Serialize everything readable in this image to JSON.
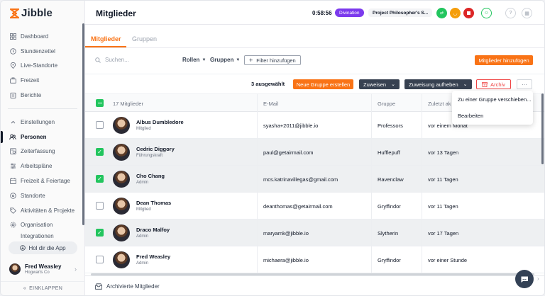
{
  "app": {
    "brand": "Jibble"
  },
  "sidebar": {
    "items_top": [
      {
        "label": "Dashboard",
        "icon": "grid-icon"
      },
      {
        "label": "Stundenzettel",
        "icon": "clock-icon"
      },
      {
        "label": "Live-Standorte",
        "icon": "pin-icon"
      },
      {
        "label": "Freizeit",
        "icon": "suitcase-icon"
      },
      {
        "label": "Berichte",
        "icon": "clipboard-icon"
      }
    ],
    "settings_label": "Einstellungen",
    "items_settings": [
      {
        "label": "Personen",
        "icon": "people-icon",
        "active": true
      },
      {
        "label": "Zeiterfassung",
        "icon": "timesheet-icon"
      },
      {
        "label": "Arbeitspläne",
        "icon": "schedule-icon"
      },
      {
        "label": "Freizeit & Feiertage",
        "icon": "calendar-icon"
      },
      {
        "label": "Standorte",
        "icon": "pin-icon"
      },
      {
        "label": "Aktivitäten & Projekte",
        "icon": "tag-icon"
      },
      {
        "label": "Organisation",
        "icon": "gear-icon"
      },
      {
        "label": "Integrationen",
        "icon": "plug-icon"
      }
    ],
    "get_app_label": "Hol dir die App",
    "user": {
      "name": "Fred Weasley",
      "org": "Hogwarts Co"
    },
    "collapse_label": "EINKLAPPEN"
  },
  "header": {
    "title": "Mitglieder",
    "timer": "0:58:56",
    "activity_badge": "Divination",
    "project_chip": "Project Philosopher's S...",
    "activity_badge_color": "#7c3aed"
  },
  "tabs": [
    {
      "label": "Mitglieder",
      "active": true
    },
    {
      "label": "Gruppen",
      "active": false
    }
  ],
  "filters": {
    "search_placeholder": "Suchen...",
    "roles_label": "Rollen",
    "groups_label": "Gruppen",
    "add_filter_label": "Filter hinzufügen",
    "add_member_label": "Mitglieder hinzufügen"
  },
  "actions": {
    "selected_count": "3 ausgewählt",
    "new_group_label": "Neue Gruppe erstellen",
    "assign_label": "Zuweisen",
    "unassign_label": "Zuweisung aufheben",
    "archive_label": "Archiv",
    "more_label": "···"
  },
  "dropdown": {
    "items": [
      "Zu einer Gruppe verschieben...",
      "Bearbeiten"
    ]
  },
  "table": {
    "columns": [
      "17 Mitglieder",
      "E-Mail",
      "Gruppe",
      "Zuletzt ak"
    ],
    "rows": [
      {
        "name": "Albus Dumbledore",
        "role": "Mitglied",
        "email": "syasha+2011@jibble.io",
        "group": "Professors",
        "last_active": "vor einem Monat",
        "selected": false
      },
      {
        "name": "Cedric Diggory",
        "role": "Führungskraft",
        "email": "paul@getairmail.com",
        "group": "Hufflepuff",
        "last_active": "vor 13 Tagen",
        "selected": true
      },
      {
        "name": "Cho Chang",
        "role": "Admin",
        "email": "mcs.katrinavillegas@gmail.com",
        "group": "Ravenclaw",
        "last_active": "vor 11 Tagen",
        "selected": true
      },
      {
        "name": "Dean Thomas",
        "role": "Mitglied",
        "email": "deanthomas@getairmail.com",
        "group": "Gryffindor",
        "last_active": "vor 11 Tagen",
        "selected": false
      },
      {
        "name": "Draco Malfoy",
        "role": "Admin",
        "email": "maryamk@jibble.io",
        "group": "Slytherin",
        "last_active": "vor 17 Tagen",
        "selected": true
      },
      {
        "name": "Fred Weasley",
        "role": "Admin",
        "email": "michaera@jibble.io",
        "group": "Gryffindor",
        "last_active": "vor einer Stunde",
        "selected": false
      }
    ]
  },
  "footer": {
    "archived_label": "Archivierte Mitglieder"
  },
  "colors": {
    "accent": "#f97316",
    "check": "#22c55e",
    "danger": "#ef4444",
    "dark_button": "#374151"
  }
}
